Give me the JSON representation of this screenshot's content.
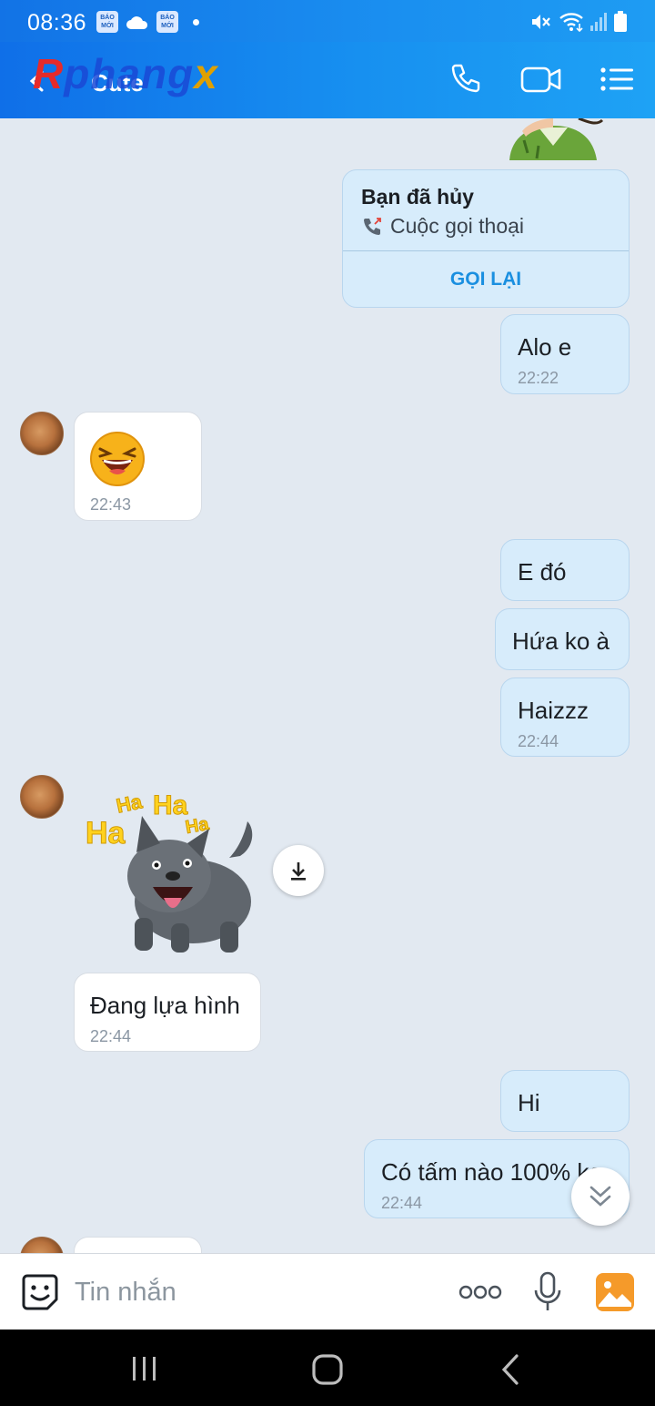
{
  "status_bar": {
    "time": "08:36",
    "badge_1": "BÁO MỚI",
    "badge_2": "BÁO MỚI"
  },
  "header": {
    "contact_name": "Cute",
    "watermark": [
      "R",
      "phang",
      "x"
    ]
  },
  "messages": {
    "call_card": {
      "title": "Bạn đã hủy",
      "subtitle": "Cuộc gọi thoại",
      "action": "GỌI LẠI"
    },
    "m1": {
      "text": "Alo e",
      "time": "22:22"
    },
    "m2": {
      "time": "22:43"
    },
    "m3": {
      "text": "E đó"
    },
    "m4": {
      "text": "Hứa ko à"
    },
    "m5": {
      "text": "Haizzz",
      "time": "22:44"
    },
    "sticker": {
      "words": [
        "Ha",
        "Ha",
        "Ha",
        "Ha"
      ]
    },
    "m6": {
      "text": "Đang lựa hình",
      "time": "22:44"
    },
    "m7": {
      "text": "Hi"
    },
    "m8": {
      "text": "Có tấm nào 100% ko",
      "time": "22:44"
    }
  },
  "input_bar": {
    "placeholder": "Tin nhắn"
  },
  "colors": {
    "header_gradient_start": "#0f6fe8",
    "header_gradient_end": "#1ea2f5",
    "outgoing_bubble": "#d7ecfb",
    "incoming_bubble": "#ffffff",
    "chat_background": "#e2e9f1",
    "accent": "#1a8fe0"
  },
  "icons": {
    "header": [
      "back-icon",
      "phone-icon",
      "video-call-icon",
      "menu-icon"
    ],
    "input": [
      "sticker-icon",
      "more-icon",
      "microphone-icon",
      "image-icon"
    ],
    "nav": [
      "recent-apps-icon",
      "home-icon",
      "nav-back-icon"
    ]
  }
}
